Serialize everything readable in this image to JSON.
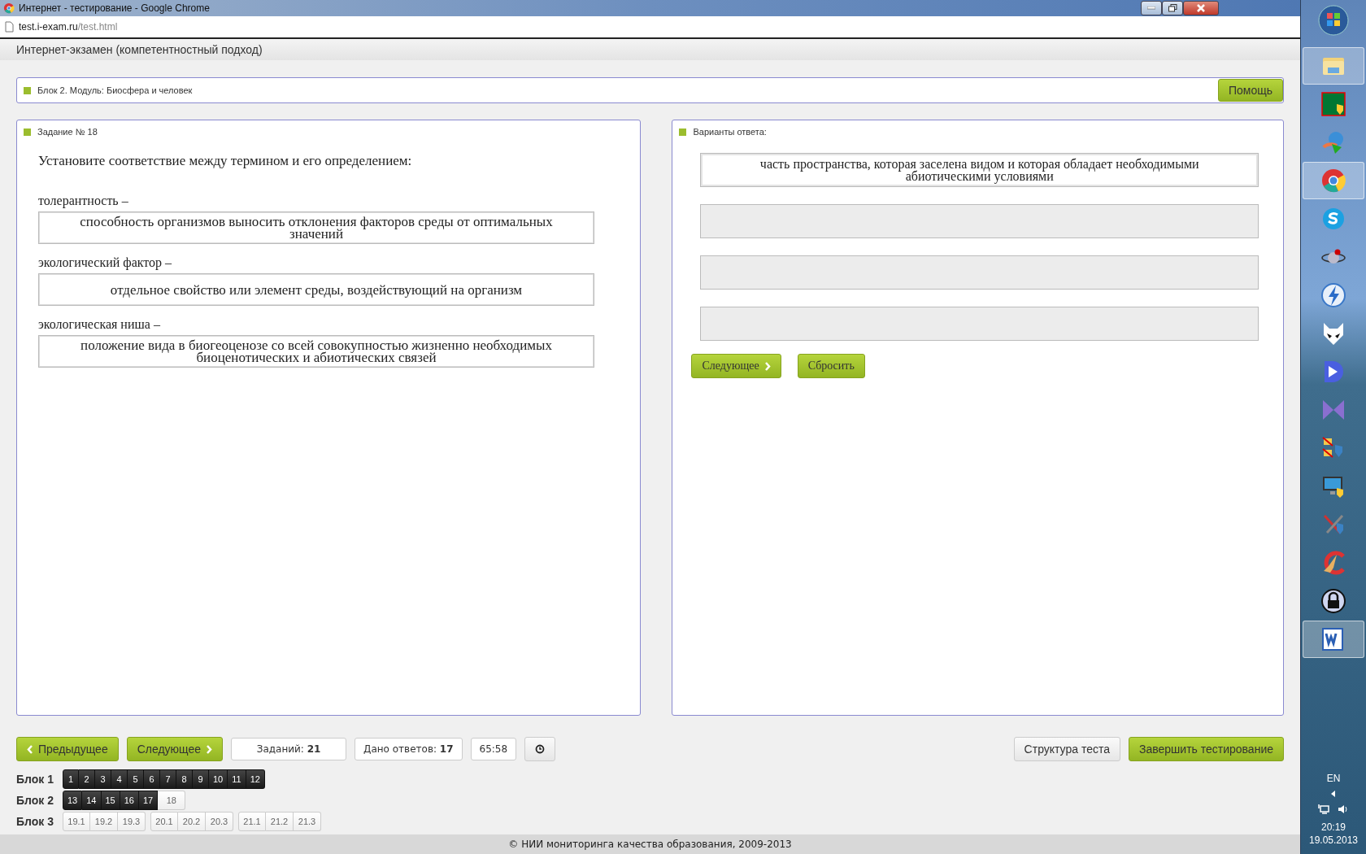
{
  "window": {
    "title": "Интернет - тестирование - Google Chrome"
  },
  "address": {
    "host": "test.i-exam.ru",
    "path": "/test.html"
  },
  "header": {
    "title": "Интернет-экзамен (компетентностный подход)"
  },
  "module_bar": {
    "label": "Блок 2. Модуль: Биосфера и человек",
    "help_button": "Помощь"
  },
  "task": {
    "label": "Задание № 18",
    "question": "Установите соответствие между термином и его определением:",
    "pairs": [
      {
        "term": "толерантность –",
        "definition": "способность организмов выносить отклонения факторов среды от оптимальных значений"
      },
      {
        "term": "экологический фактор –",
        "definition": "отдельное свойство или элемент среды, воздействующий на организм"
      },
      {
        "term": "экологическая ниша –",
        "definition": "положение вида в биогеоценозе со всей совокупностью жизненно необходимых биоценотических и абиотических связей"
      }
    ]
  },
  "answers": {
    "label": "Варианты ответа:",
    "options": [
      {
        "text": "часть пространства, которая заселена видом и которая обладает необходимыми абиотическими условиями",
        "empty": false
      },
      {
        "empty": true
      },
      {
        "empty": true
      },
      {
        "empty": true
      }
    ],
    "next_button": "Следующее",
    "reset_button": "Сбросить"
  },
  "toolbar": {
    "prev_button": "Предыдущее",
    "next_button": "Следующее",
    "tasks_count": "Заданий: **21**",
    "answered_count": "Дано ответов: **17**",
    "timer": "65:58",
    "structure_button": "Структура теста",
    "finish_button": "Завершить тестирование"
  },
  "blocks": [
    {
      "label": "Блок 1",
      "groups": [
        [
          {
            "num": "1",
            "answered": true
          },
          {
            "num": "2",
            "answered": true
          },
          {
            "num": "3",
            "answered": true
          },
          {
            "num": "4",
            "answered": true
          },
          {
            "num": "5",
            "answered": true
          },
          {
            "num": "6",
            "answered": true
          },
          {
            "num": "7",
            "answered": true
          },
          {
            "num": "8",
            "answered": true
          },
          {
            "num": "9",
            "answered": true
          },
          {
            "num": "10",
            "answered": true
          },
          {
            "num": "11",
            "answered": true
          },
          {
            "num": "12",
            "answered": true
          }
        ]
      ]
    },
    {
      "label": "Блок 2",
      "groups": [
        [
          {
            "num": "13",
            "answered": true
          },
          {
            "num": "14",
            "answered": true
          },
          {
            "num": "15",
            "answered": true
          },
          {
            "num": "16",
            "answered": true
          },
          {
            "num": "17",
            "answered": true
          },
          {
            "num": "18",
            "answered": false
          }
        ]
      ]
    },
    {
      "label": "Блок 3",
      "groups": [
        [
          {
            "num": "19.1",
            "answered": false
          },
          {
            "num": "19.2",
            "answered": false
          },
          {
            "num": "19.3",
            "answered": false
          }
        ],
        [
          {
            "num": "20.1",
            "answered": false
          },
          {
            "num": "20.2",
            "answered": false
          },
          {
            "num": "20.3",
            "answered": false
          }
        ],
        [
          {
            "num": "21.1",
            "answered": false
          },
          {
            "num": "21.2",
            "answered": false
          },
          {
            "num": "21.3",
            "answered": false
          }
        ]
      ]
    }
  ],
  "footer": {
    "text": "© НИИ мониторинга качества образования, 2009-2013"
  },
  "taskbar": {
    "icons": [
      {
        "kind": "folder",
        "active": true
      },
      {
        "kind": "matrix",
        "active": false
      },
      {
        "kind": "globe",
        "active": false
      },
      {
        "kind": "chrome",
        "active": true
      },
      {
        "kind": "skype",
        "active": false
      },
      {
        "kind": "atom",
        "active": false
      },
      {
        "kind": "lightning",
        "active": false
      },
      {
        "kind": "mask",
        "active": false
      },
      {
        "kind": "play",
        "active": false
      },
      {
        "kind": "bowtie",
        "active": false
      },
      {
        "kind": "shieldx",
        "active": false
      },
      {
        "kind": "monitor",
        "active": false
      },
      {
        "kind": "tools",
        "active": false
      },
      {
        "kind": "broom",
        "active": false
      },
      {
        "kind": "lock",
        "active": false
      },
      {
        "kind": "word",
        "active": true
      }
    ],
    "language": "EN",
    "time": "20:19",
    "date": "19.05.2013"
  }
}
